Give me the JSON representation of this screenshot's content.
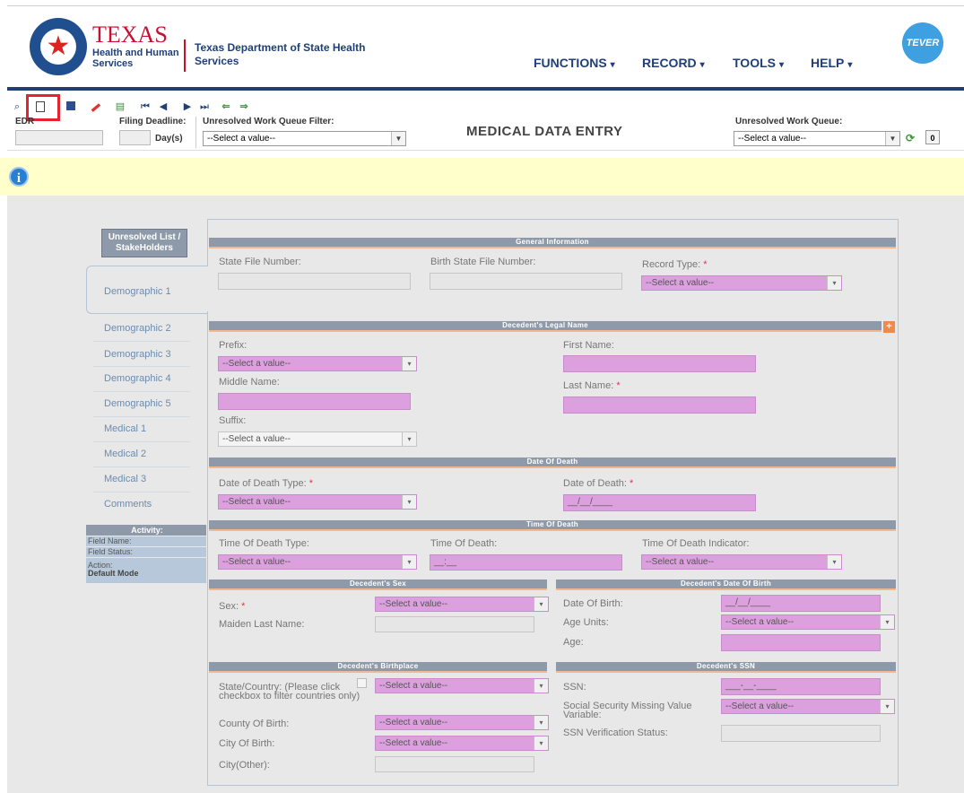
{
  "header": {
    "logo_big": "TEXAS",
    "logo_sub": "Health and Human Services",
    "dept": "Texas Department of State Health Services",
    "nav": [
      "FUNCTIONS",
      "RECORD",
      "TOOLS",
      "HELP"
    ],
    "tever_logo": "TEVER"
  },
  "toolbar": {
    "edr_label": "EDR",
    "filing_label": "Filing Deadline:",
    "days_label": "Day(s)",
    "filter_label": "Unresolved Work Queue Filter:",
    "filter_value": "--Select a value--",
    "page_title": "MEDICAL DATA ENTRY",
    "queue_label": "Unresolved Work Queue:",
    "queue_value": "--Select a value--",
    "queue_count": "0"
  },
  "left_nav": {
    "unresolved_btn": "Unresolved List / StakeHolders",
    "items": [
      "Demographic 1",
      "Demographic 2",
      "Demographic 3",
      "Demographic 4",
      "Demographic 5",
      "Medical 1",
      "Medical 2",
      "Medical 3",
      "Comments"
    ],
    "activity_title": "Activity:",
    "field_name_label": "Field Name:",
    "field_status_label": "Field Status:",
    "action_label": "Action:",
    "action_value": "Default Mode"
  },
  "general": {
    "title": "General Information",
    "state_file_label": "State File Number:",
    "birth_file_label": "Birth State File Number:",
    "record_type_label": "Record Type:",
    "record_type_value": "--Select a value--"
  },
  "legal_name": {
    "title": "Decedent's Legal Name",
    "prefix_label": "Prefix:",
    "prefix_value": "--Select a value--",
    "first_label": "First Name:",
    "middle_label": "Middle Name:",
    "last_label": "Last Name:",
    "suffix_label": "Suffix:",
    "suffix_value": "--Select a value--"
  },
  "date_of_death": {
    "title": "Date Of Death",
    "type_label": "Date of Death Type:",
    "type_value": "--Select a value--",
    "date_label": "Date of Death:",
    "date_value": "__/__/____"
  },
  "time_of_death": {
    "title": "Time Of Death",
    "type_label": "Time Of Death Type:",
    "type_value": "--Select a value--",
    "time_label": "Time Of Death:",
    "time_value": "__:__",
    "indicator_label": "Time Of Death Indicator:",
    "indicator_value": "--Select a value--"
  },
  "sex": {
    "title": "Decedent's Sex",
    "sex_label": "Sex:",
    "sex_value": "--Select a value--",
    "maiden_label": "Maiden Last Name:"
  },
  "dob": {
    "title": "Decedent's Date Of Birth",
    "dob_label": "Date Of Birth:",
    "dob_value": "__/__/____",
    "age_units_label": "Age Units:",
    "age_units_value": "--Select a value--",
    "age_label": "Age:"
  },
  "birthplace": {
    "title": "Decedent's Birthplace",
    "state_label": "State/Country: (Please click checkbox to filter countries only)",
    "state_value": "--Select a value--",
    "county_label": "County Of Birth:",
    "county_value": "--Select a value--",
    "city_label": "City Of Birth:",
    "city_value": "--Select a value--",
    "city_other_label": "City(Other):"
  },
  "ssn": {
    "title": "Decedent's SSN",
    "ssn_label": "SSN:",
    "ssn_value": "___-__-____",
    "missing_label": "Social Security Missing Value Variable:",
    "missing_value": "--Select a value--",
    "verification_label": "SSN Verification Status:"
  },
  "colors": {
    "navy": "#1f3f79",
    "red": "#c8102e",
    "pink_field": "#dba0dd",
    "section_bar": "#8e9aaa",
    "info_bar": "#ffffcc"
  }
}
